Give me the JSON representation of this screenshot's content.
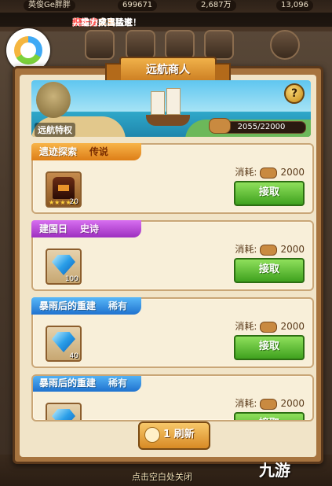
{
  "top": {
    "gold": "699671",
    "diamond": "2,687万",
    "gems": "13,096",
    "player_name": "英俊Ge胖胖"
  },
  "marquee": {
    "prefix": "天啦噜，冒险家",
    "player": "暴走之公主",
    "mid": "成功合成出",
    "stars": "6星",
    "hero_prefix": "英雄",
    "hero": "炽天使",
    "suffix": "，实力突飞猛进！"
  },
  "modal": {
    "title": "远航商人",
    "banner": {
      "label": "远航特权",
      "help": "?",
      "progress": "2055/22000"
    }
  },
  "cards": [
    {
      "name": "遗迹探索",
      "rarity": "传说",
      "cost_label": "消耗:",
      "cost": "2000",
      "button": "接取",
      "item_stars": "★★★★★",
      "item_qty": "20"
    },
    {
      "name": "建国日",
      "rarity": "史诗",
      "cost_label": "消耗:",
      "cost": "2000",
      "button": "接取",
      "item_qty": "100"
    },
    {
      "name": "暴雨后的重建",
      "rarity": "稀有",
      "cost_label": "消耗:",
      "cost": "2000",
      "button": "接取",
      "item_qty": "40"
    },
    {
      "name": "暴雨后的重建",
      "rarity": "稀有",
      "cost_label": "消耗:",
      "cost": "2000",
      "button": "接取"
    }
  ],
  "footer": {
    "refresh": "1 刷新",
    "close_hint": "点击空白处关闭",
    "watermark": "九游"
  },
  "colors": {
    "accent_orange": "#dd7e17",
    "epic_purple": "#9d2fbf",
    "rare_blue": "#1f72cf",
    "accept_green": "#3fa11e"
  }
}
